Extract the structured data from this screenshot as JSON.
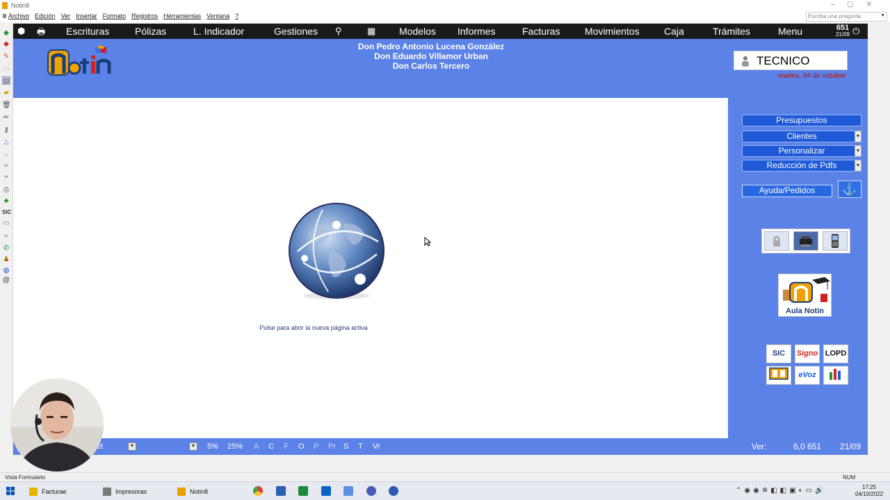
{
  "window": {
    "title": "Notin8"
  },
  "menubar": {
    "items": [
      "Archivo",
      "Edición",
      "Ver",
      "Insertar",
      "Formato",
      "Registros",
      "Herramientas",
      "Ventana",
      "?"
    ],
    "help_placeholder": "Escriba una pregunta"
  },
  "navbar": {
    "items": [
      "Escrituras",
      "Pólizas",
      "L. Indicador",
      "Gestiones",
      "Modelos",
      "Informes",
      "Facturas",
      "Movimientos",
      "Caja",
      "Trámites",
      "Menu"
    ],
    "counter": "651",
    "counter_date": "21/09"
  },
  "header": {
    "notaries": [
      "Don Pedro Antonio Lucena González",
      "Don Eduardo Villamor Urban",
      "Don Carlos Tercero"
    ],
    "user": "TECNICO",
    "date": "martes, 04 de octubre"
  },
  "rightpanel": {
    "buttons": [
      "Presupuestos",
      "Clientes",
      "Personalizar",
      "Reducción de Pdfs"
    ],
    "ayuda": "Ayuda/Pedidos",
    "aula_label": "Aula Notin",
    "minis": [
      "SIC",
      "Signo",
      "LOPD",
      "",
      "eVoz",
      ""
    ]
  },
  "content": {
    "caption": "Pulse para abrir la nueva página activa"
  },
  "bottombar": {
    "field_text": "et",
    "percent_a": "5%",
    "percent_b": "25%",
    "flags": [
      "A",
      "C",
      "F",
      "O",
      "P",
      "Pr",
      "S",
      "T",
      "Vr"
    ],
    "version_label": "Ver:",
    "version": "6,0 651",
    "version_date": "21/09"
  },
  "statusbar": {
    "left": "Vista Formulario",
    "num": "NUM"
  },
  "taskbar": {
    "apps": [
      "Facturae",
      "Impresoras",
      "Notin8"
    ],
    "time": "17:25",
    "date": "04/10/2022"
  },
  "colors": {
    "header_blue": "#5b82e6",
    "button_blue": "#1e5ad8",
    "navbar_black": "#1a1a1a",
    "date_red": "#b01010"
  }
}
